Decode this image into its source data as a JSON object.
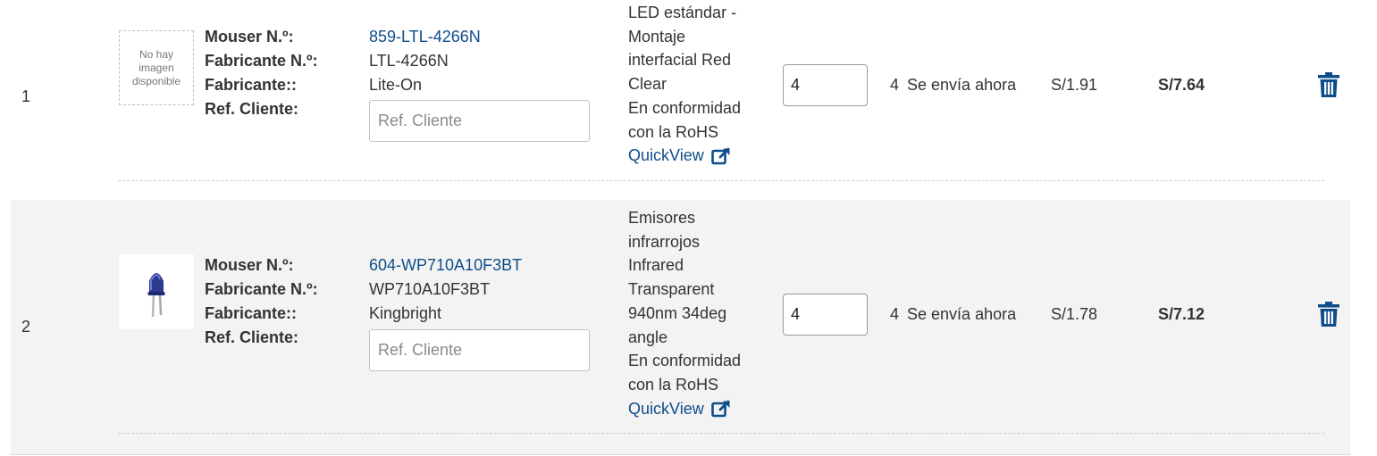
{
  "rows": [
    {
      "index": "1",
      "image_placeholder": "No hay imagen disponible",
      "labels": {
        "mouser_no": "Mouser N.º:",
        "manufacturer_no": "Fabricante N.º:",
        "manufacturer": "Fabricante::",
        "customer_ref": "Ref. Cliente:"
      },
      "mouser_no": "859-LTL-4266N",
      "manufacturer_no": "LTL-4266N",
      "manufacturer": "Lite-On",
      "customer_ref_placeholder": "Ref. Cliente",
      "description_lines": [
        "LED estándar -",
        "Montaje",
        "interfacial Red",
        "Clear"
      ],
      "rohs_lines": [
        "En conformidad",
        "con la RoHS"
      ],
      "quickview": "QuickView",
      "quantity": "4",
      "ship_count": "4",
      "ship_text": "Se envía ahora",
      "unit_price": "S/1.91",
      "total_price": "S/7.64"
    },
    {
      "index": "2",
      "image_alt": "LED infrared emitter",
      "labels": {
        "mouser_no": "Mouser N.º:",
        "manufacturer_no": "Fabricante N.º:",
        "manufacturer": "Fabricante::",
        "customer_ref": "Ref. Cliente:"
      },
      "mouser_no": "604-WP710A10F3BT",
      "manufacturer_no": "WP710A10F3BT",
      "manufacturer": "Kingbright",
      "customer_ref_placeholder": "Ref. Cliente",
      "description_lines": [
        "Emisores",
        "infrarrojos",
        "Infrared",
        "Transparent",
        "940nm 34deg",
        "angle"
      ],
      "rohs_lines": [
        "En conformidad",
        "con la RoHS"
      ],
      "quickview": "QuickView",
      "quantity": "4",
      "ship_count": "4",
      "ship_text": "Se envía ahora",
      "unit_price": "S/1.78",
      "total_price": "S/7.12"
    }
  ],
  "colors": {
    "link": "#0f4d8a",
    "row_alt_bg": "#f3f3f3",
    "trash_icon": "#0f4d8a"
  },
  "icons": {
    "quickview": "external-link-icon",
    "delete": "trash-icon"
  }
}
